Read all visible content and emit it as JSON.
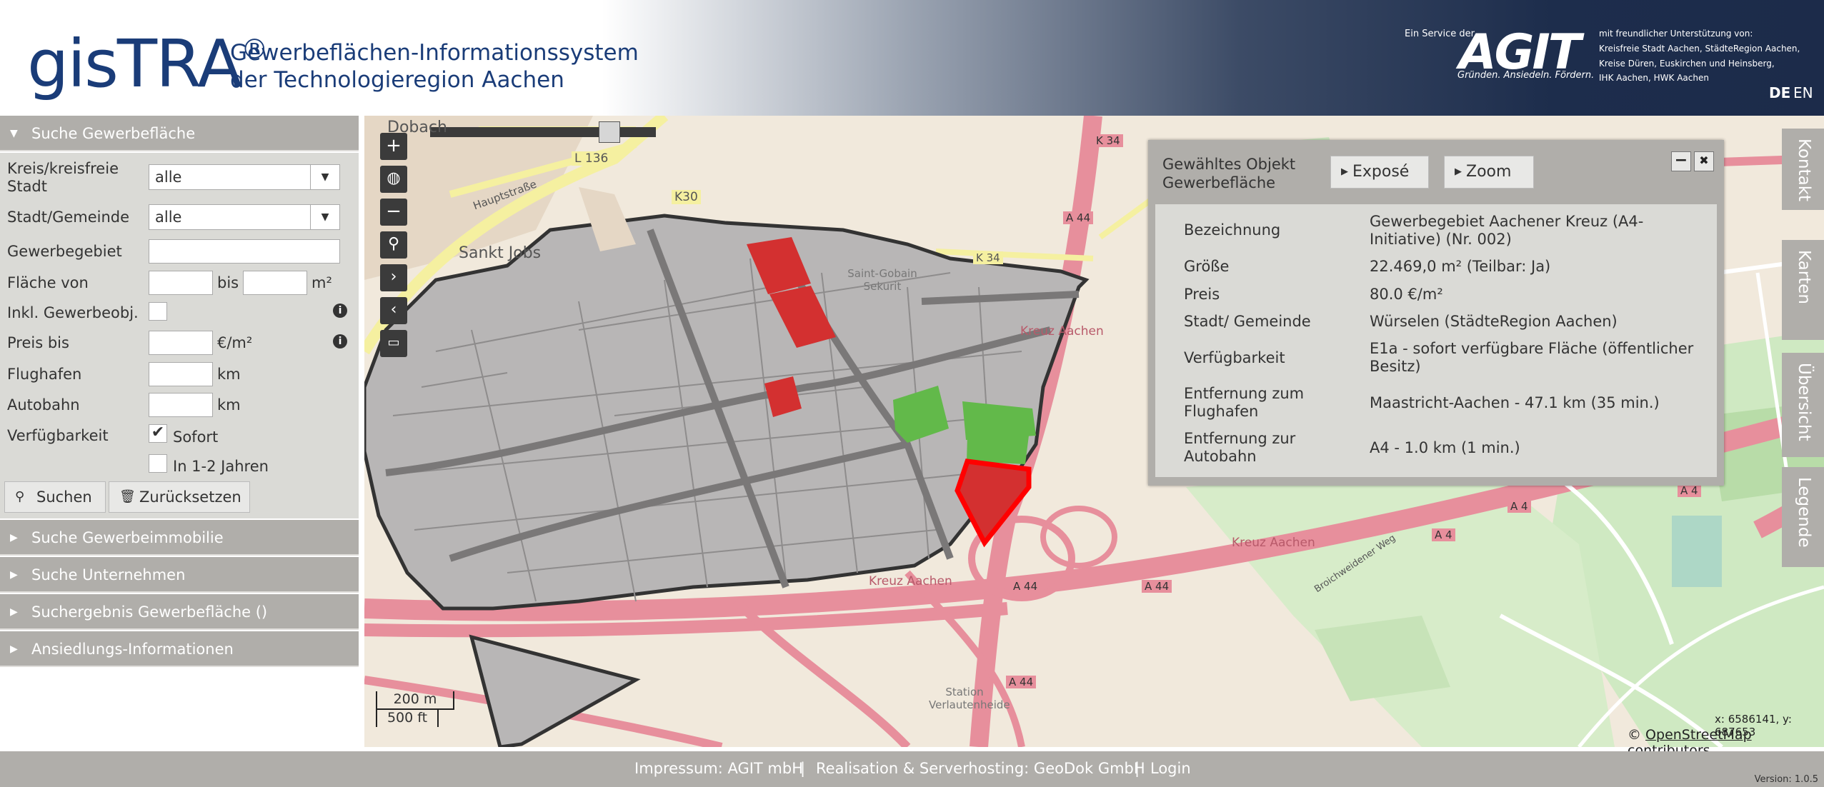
{
  "header": {
    "logo": "gisTRA",
    "reg": "®",
    "subtitle_line1": "Gewerbeflächen-Informationssystem",
    "subtitle_line2": "der Technologieregion Aachen",
    "service_label": "Ein Service der",
    "agit_logo": "AGIT",
    "agit_tagline": "Gründen. Ansiedeln. Fördern.",
    "support_lines": [
      "mit freundlicher Unterstützung von:",
      "Kreisfreie Stadt Aachen, StädteRegion Aachen,",
      "Kreise Düren, Euskirchen und Heinsberg,",
      "IHK Aachen, HWK Aachen"
    ],
    "lang_de": "DE",
    "lang_en": "EN"
  },
  "sidebar": {
    "search_title": "Suche Gewerbefläche",
    "form": {
      "kreis_label": "Kreis/kreisfreie Stadt",
      "kreis_value": "alle",
      "stadt_label": "Stadt/Gemeinde",
      "stadt_value": "alle",
      "gewerbegebiet_label": "Gewerbegebiet",
      "flaeche_label": "Fläche von",
      "bis_label": "bis",
      "flaeche_unit": "m²",
      "inkl_label": "Inkl. Gewerbeobj.",
      "preis_label": "Preis bis",
      "preis_unit": "€/m²",
      "flughafen_label": "Flughafen",
      "flughafen_unit": "km",
      "autobahn_label": "Autobahn",
      "autobahn_unit": "km",
      "verfuegbarkeit_label": "Verfügbarkeit",
      "sofort_label": "Sofort",
      "sofort_checked": "✔",
      "jahre_label": "In 1-2 Jahren",
      "search_button": "Suchen",
      "reset_button": "Zurücksetzen"
    },
    "sections": [
      "Suche Gewerbeimmobilie",
      "Suche Unternehmen",
      "Suchergebnis Gewerbefläche ()",
      "Ansiedlungs-Informationen"
    ]
  },
  "map": {
    "labels": {
      "dobach": "Dobach",
      "sankt_jobs": "Sankt Jobs",
      "l136": "L 136",
      "k30": "K30",
      "k34a": "K 34",
      "k34b": "K 34",
      "a44a": "A 44",
      "a44b": "A 44",
      "a44c": "A 44",
      "a44d": "A 44",
      "a4a": "A 4",
      "a4b": "A 4",
      "a4c": "A 4",
      "kreuz1": "Kreuz Aachen",
      "kreuz2": "Kreuz Aachen",
      "kreuz3": "Kreuz Aachen",
      "saint_gobain": "Saint-Gobain Sekurit",
      "station": "Station Verlautenheide",
      "weg": "Broichweidener Weg",
      "haupt": "Hauptstraße"
    },
    "scale_m": "200 m",
    "scale_ft": "500 ft",
    "coords": "x: 6586141, y: 687653",
    "attribution_prefix": "©",
    "attribution_link": "OpenStreetMap",
    "attribution_suffix": "contributors"
  },
  "feature_panel": {
    "title_line1": "Gewähltes Objekt",
    "title_line2": "Gewerbefläche",
    "expose_button": "Exposé",
    "zoom_button": "Zoom",
    "minimize": "−",
    "close": "✖",
    "rows": [
      {
        "key": "Bezeichnung",
        "value": "Gewerbegebiet Aachener Kreuz (A4-Initiative) (Nr. 002)"
      },
      {
        "key": "Größe",
        "value": "22.469,0 m² (Teilbar: Ja)"
      },
      {
        "key": "Preis",
        "value": "80.0 €/m²"
      },
      {
        "key": "Stadt/ Gemeinde",
        "value": "Würselen (StädteRegion Aachen)"
      },
      {
        "key": "Verfügbarkeit",
        "value": "E1a - sofort verfügbare Fläche (öffentlicher Besitz)"
      },
      {
        "key": "Entfernung zum Flughafen",
        "value": "Maastricht-Aachen - 47.1 km (35 min.)"
      },
      {
        "key": "Entfernung zur Autobahn",
        "value": "A4 - 1.0 km (1 min.)"
      }
    ]
  },
  "side_tabs": [
    "Kontakt",
    "Karten",
    "Übersicht",
    "Legende"
  ],
  "footer": {
    "impressum": "Impressum: AGIT mbH",
    "realisation": "Realisation & Serverhosting: GeoDok GmbH",
    "login": "Login",
    "sep": "|",
    "version": "Version: 1.0.5"
  },
  "colors": {
    "header_dark": "#1c2b4a",
    "logo_blue": "#1a3c78",
    "panel_grey": "#b0aeaa",
    "form_grey": "#dadad6",
    "motorway": "#e78f9c",
    "parcel_selected": "#d33030",
    "parcel_green": "#62b94a"
  }
}
